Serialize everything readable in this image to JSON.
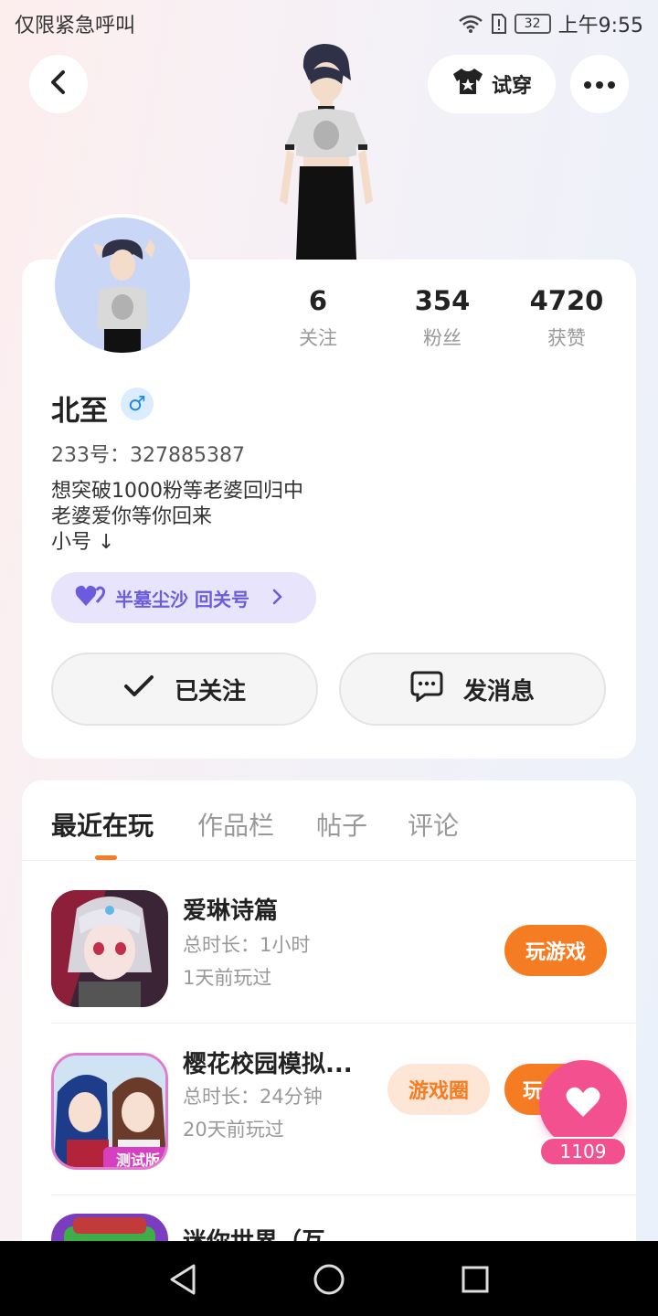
{
  "status_bar": {
    "emergency_text": "仅限紧急呼叫",
    "battery_level": "32",
    "time": "上午9:55",
    "icons": [
      "wifi-icon",
      "sim-alert-icon",
      "battery-icon"
    ]
  },
  "header": {
    "back_icon": "chevron-left-icon",
    "try_on_label": "试穿",
    "try_on_icon": "shirt-icon",
    "more_icon": "more-dots-icon"
  },
  "profile": {
    "stats": [
      {
        "value": "6",
        "label": "关注"
      },
      {
        "value": "354",
        "label": "粉丝"
      },
      {
        "value": "4720",
        "label": "获赞"
      }
    ],
    "name": "北至",
    "gender_symbol": "♂",
    "uid": "233号：327885387",
    "bio_lines": [
      "想突破1000粉等老婆回归中",
      "老婆爱你等你回来",
      "小号 ↓"
    ],
    "relation_tag": "半墓尘沙 回关号",
    "relation_icon": "double-heart-icon",
    "follow_label": "已关注",
    "message_label": "发消息"
  },
  "tabs": [
    {
      "label": "最近在玩",
      "active": true
    },
    {
      "label": "作品栏",
      "active": false
    },
    {
      "label": "帖子",
      "active": false
    },
    {
      "label": "评论",
      "active": false
    }
  ],
  "games": [
    {
      "title": "爱琳诗篇",
      "duration": "总时长：1小时",
      "last_played": "1天前玩过",
      "play_label": "玩游戏"
    },
    {
      "title": "樱花校园模拟...",
      "duration": "总时长：24分钟",
      "last_played": "20天前玩过",
      "circle_label": "游戏圈",
      "play_label": "玩",
      "badge": "测试版"
    },
    {
      "title": "迷你世界（互"
    }
  ],
  "like": {
    "count": "1109"
  },
  "colors": {
    "accent": "#f57c22",
    "like_pink": "#f2508e",
    "relation_purple": "#6b5bdd"
  }
}
